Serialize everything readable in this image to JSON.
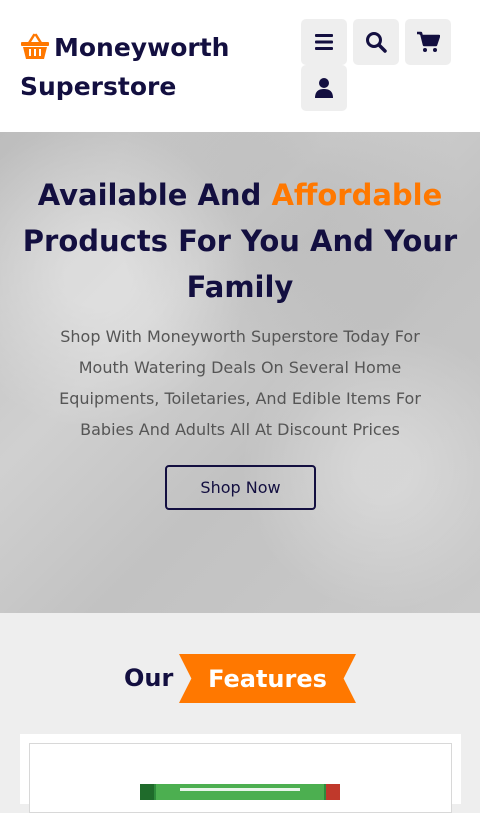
{
  "header": {
    "logo_line1": "Moneyworth",
    "logo_line2": "Superstore",
    "buttons": [
      {
        "name": "menu-button",
        "icon": "bars-icon"
      },
      {
        "name": "search-button",
        "icon": "search-icon"
      },
      {
        "name": "cart-button",
        "icon": "shopping-cart-icon"
      },
      {
        "name": "login-button",
        "icon": "user-icon"
      }
    ]
  },
  "hero": {
    "title_part1": "Available And ",
    "title_accent": "Affordable",
    "title_part2": "Products For You And Your Family",
    "description": "Shop With Moneyworth Superstore Today For Mouth Watering Deals On Several Home Equipments, Toiletaries, And Edible Items For Babies And Adults All At Discount Prices",
    "cta_label": "Shop Now"
  },
  "features": {
    "heading_plain": "Our",
    "heading_tag": "Features"
  },
  "colors": {
    "brand_dark": "#130f40",
    "accent": "#ff7800",
    "background": "#eeeeee"
  }
}
